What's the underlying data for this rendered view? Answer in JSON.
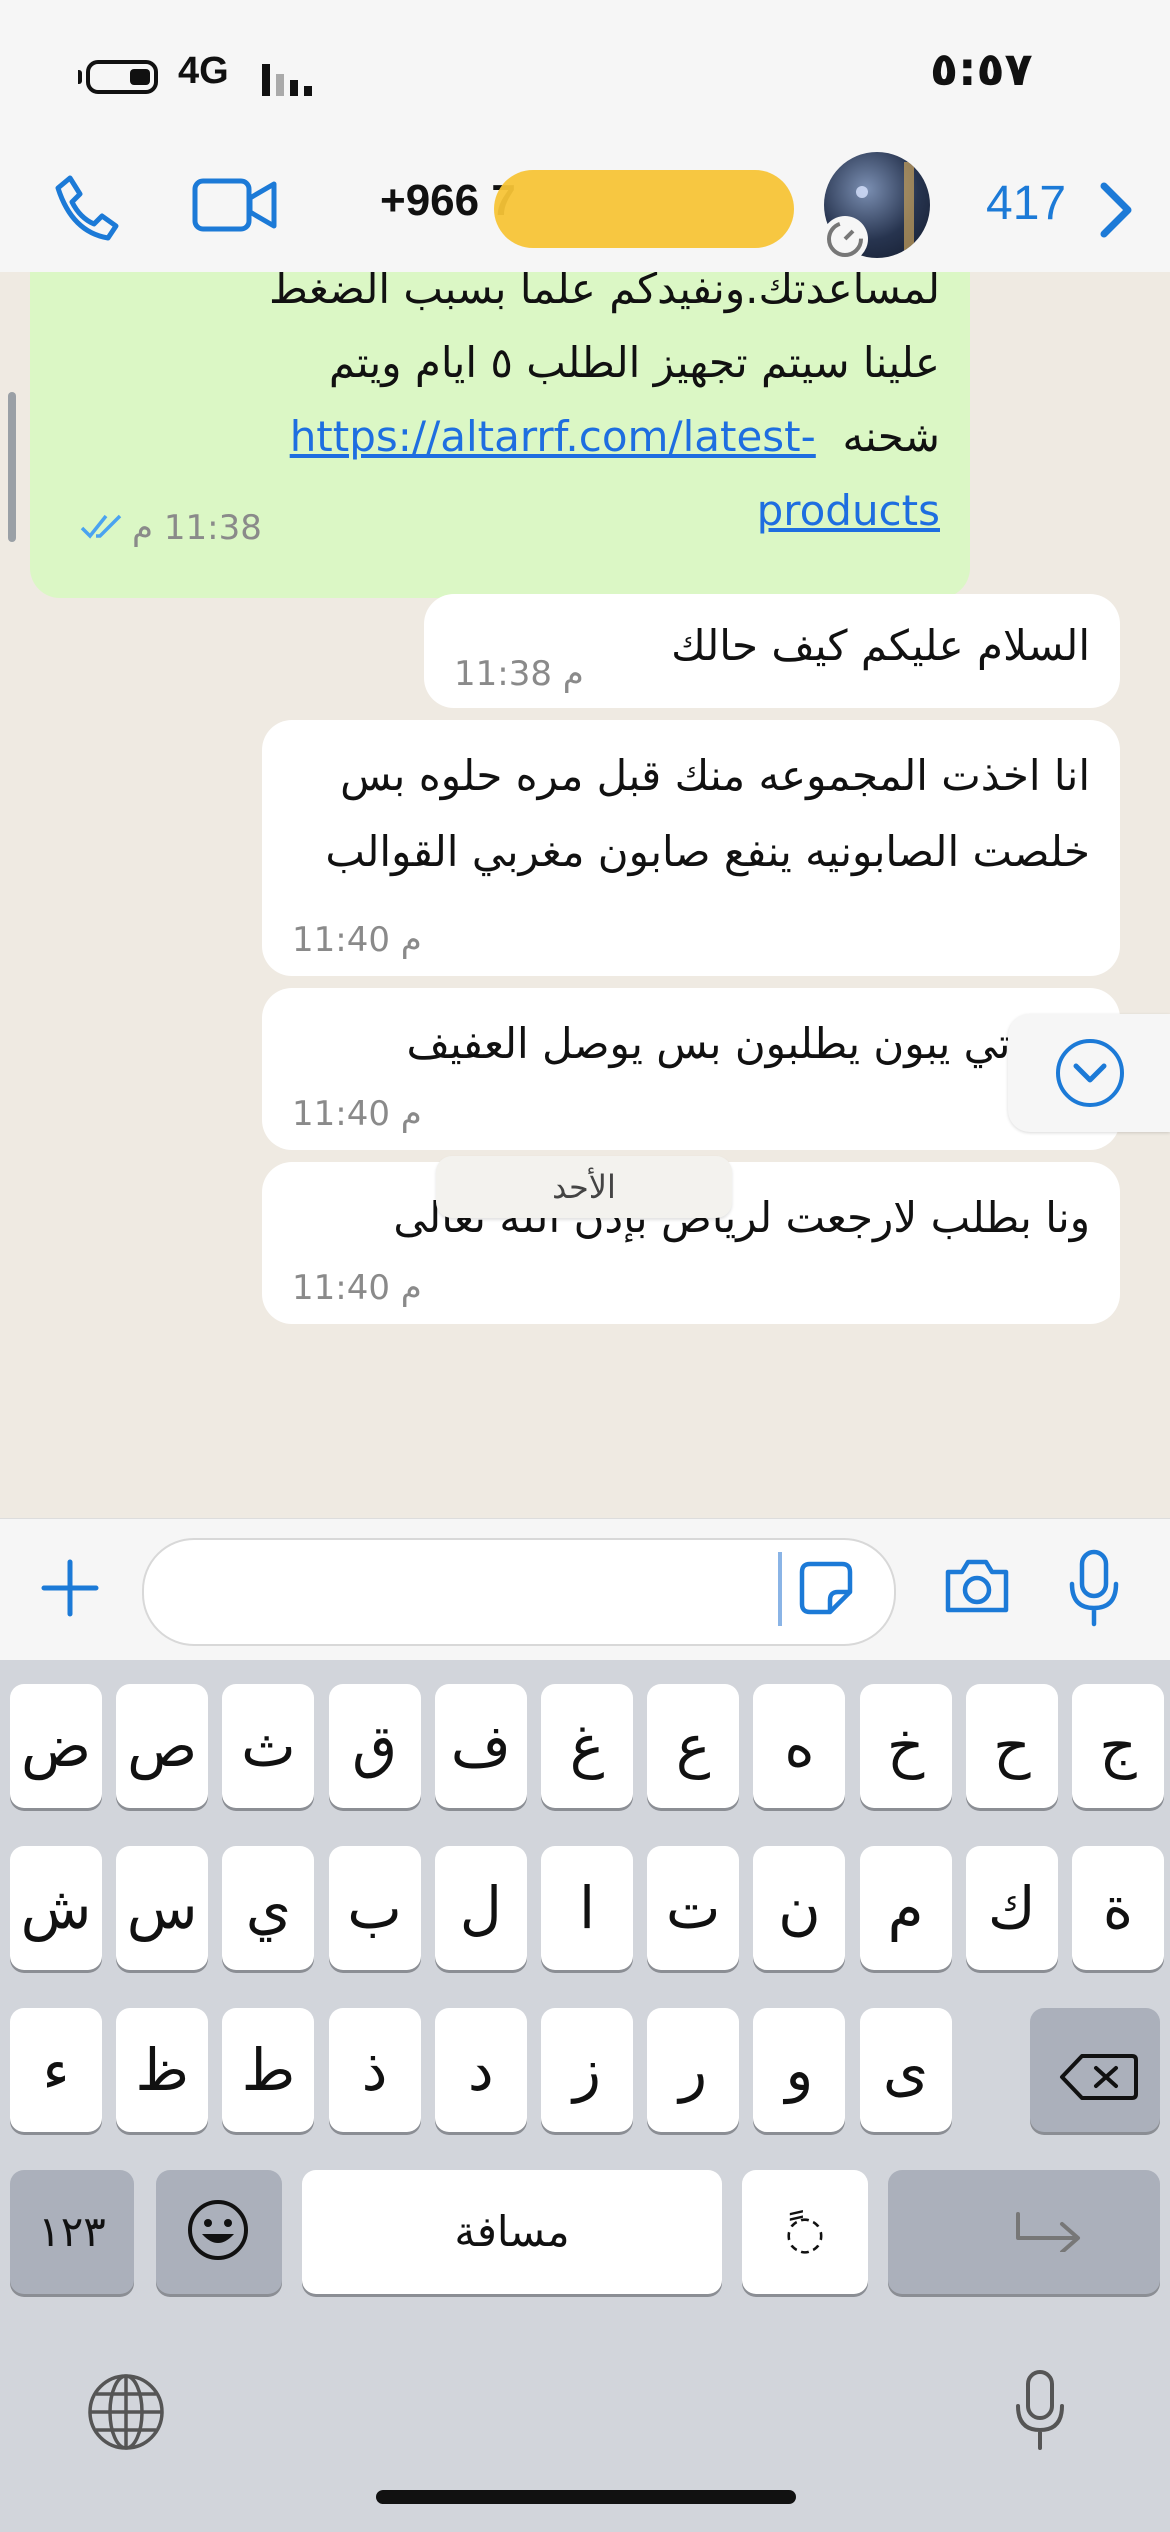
{
  "status_bar": {
    "time": "٥:٥٧",
    "network": "4G"
  },
  "header": {
    "contact_name": "+966            7",
    "unread_count": "417"
  },
  "chat": {
    "outgoing": {
      "lines": [
        "لمساعدتك.ونفيدكم علما بسبب الضغط",
        "علينا سيتم تجهيز الطلب  ٥ ايام ويتم",
        "شحنه"
      ],
      "link_line1": "https://altarrf.com/latest-",
      "link_line2": "products",
      "time": "11:38 م"
    },
    "incoming": [
      {
        "text": "السلام عليكم كيف حالك",
        "time": "11:38 م"
      },
      {
        "text": "انا اخذت المجموعه منك قبل مره حلوه بس خلصت الصابونيه ينفع صابون مغربي القوالب",
        "time": "11:40 م"
      },
      {
        "text": "وخواتي يبون يطلبون بس يوصل العفيف",
        "time": "11:40 م"
      },
      {
        "text": "ونا بطلب لارجعت لرياض بإذن الله تعالى",
        "time": "11:40 م"
      }
    ],
    "day_separator": "الأحد"
  },
  "composer": {
    "placeholder": ""
  },
  "keyboard": {
    "row1": [
      "ض",
      "ص",
      "ث",
      "ق",
      "ف",
      "غ",
      "ع",
      "ه",
      "خ",
      "ح",
      "ج"
    ],
    "row2": [
      "ش",
      "س",
      "ي",
      "ب",
      "ل",
      "ا",
      "ت",
      "ن",
      "م",
      "ك",
      "ة"
    ],
    "row3": [
      "ء",
      "ظ",
      "ط",
      "ذ",
      "د",
      "ز",
      "ر",
      "و",
      "ى"
    ],
    "numbers_label": "١٢٣",
    "space_label": "مسافة",
    "diacritic_label": "ً◌"
  }
}
